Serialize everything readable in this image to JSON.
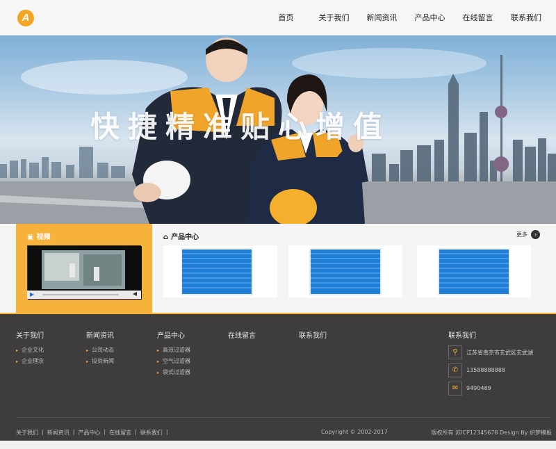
{
  "header": {
    "logo_text": "A",
    "nav": [
      "首页",
      "关于我们",
      "新闻资讯",
      "产品中心",
      "在线留言",
      "联系我们"
    ]
  },
  "banner": {
    "slogan": "快捷精准贴心增值"
  },
  "video": {
    "title": "视频"
  },
  "products": {
    "title": "产品中心",
    "more": "更多"
  },
  "footer": {
    "columns": [
      {
        "title": "关于我们",
        "links": [
          "企业文化",
          "企业理念"
        ]
      },
      {
        "title": "新闻资讯",
        "links": [
          "公司动态",
          "投资新闻"
        ]
      },
      {
        "title": "产品中心",
        "links": [
          "高效过滤器",
          "空气过滤器",
          "袋式过滤器"
        ]
      },
      {
        "title": "在线留言",
        "links": []
      },
      {
        "title": "联系我们",
        "links": []
      }
    ],
    "contact": {
      "title": "联系我们",
      "address": "江苏省南京市玄武区玄武湖",
      "phone": "13588888888",
      "email": "9490489"
    },
    "bottom_links": [
      "关于我们",
      "新闻资讯",
      "产品中心",
      "在线留言",
      "联系我们"
    ],
    "copyright": "Copyright © 2002-2017",
    "icp": "版权所有 苏ICP12345678 Design By 织梦模板"
  },
  "colors": {
    "accent": "#f7b23c",
    "footer_bg": "#3e3c3c",
    "filter_blue": "#1f7fd6"
  }
}
